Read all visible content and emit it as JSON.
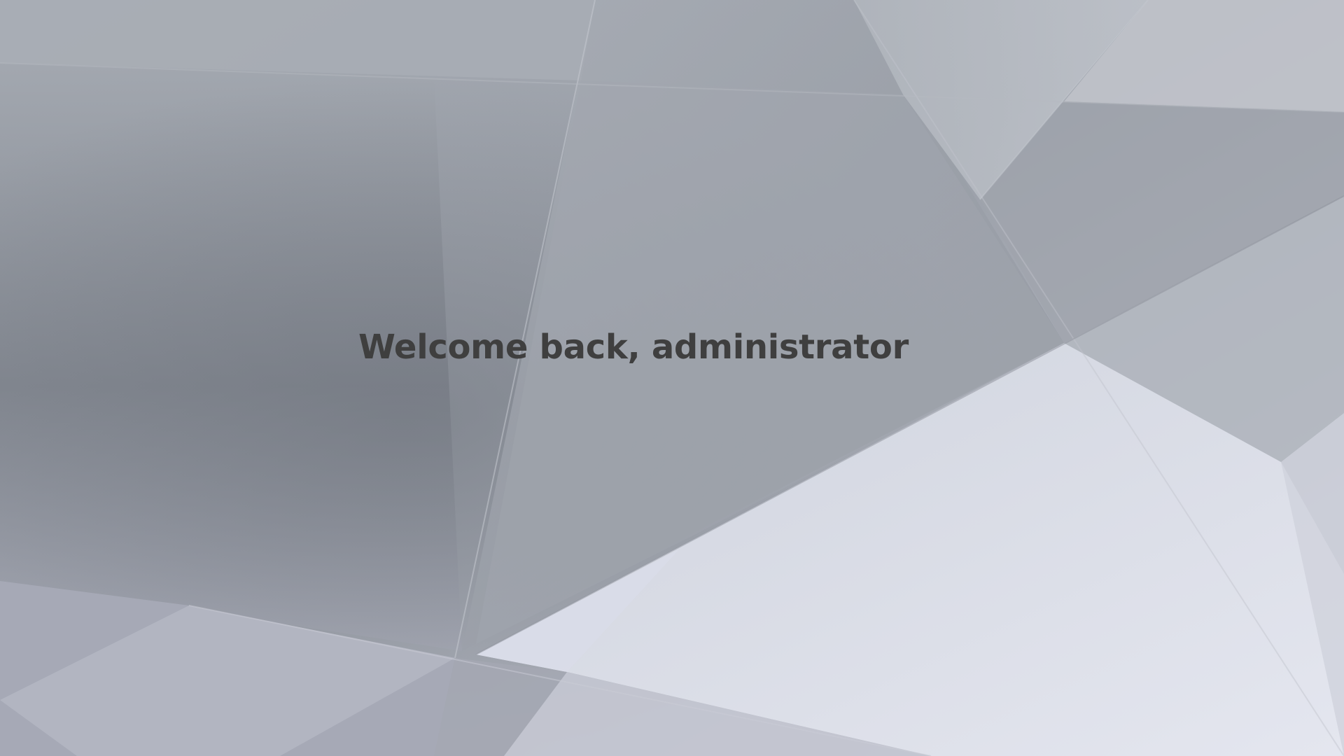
{
  "screen": {
    "welcome_message": "Welcome back, administrator",
    "text_color": "#3f3f3f",
    "background": {
      "style": "abstract-geometric-gray",
      "base_color": "#aab0b8",
      "dark_tone": "#7e838c",
      "light_tone": "#dfe2ec"
    }
  }
}
